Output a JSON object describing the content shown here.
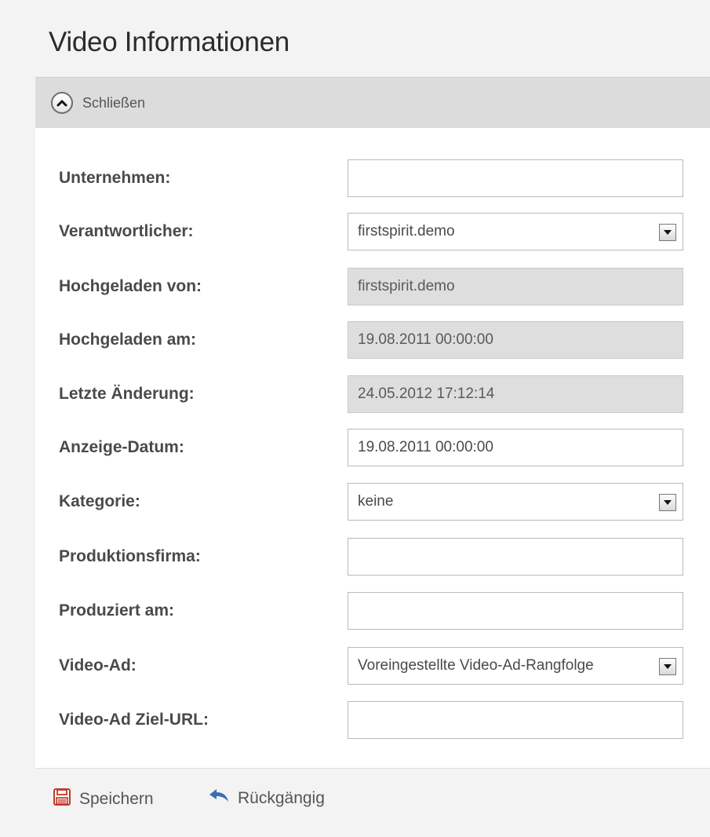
{
  "panel": {
    "title": "Video Informationen",
    "collapse_label": "Schließen"
  },
  "form": {
    "rows": [
      {
        "label": "Unternehmen:",
        "value": "",
        "type": "text"
      },
      {
        "label": "Verantwortlicher:",
        "value": "firstspirit.demo",
        "type": "select"
      },
      {
        "label": "Hochgeladen von:",
        "value": "firstspirit.demo",
        "type": "readonly"
      },
      {
        "label": "Hochgeladen am:",
        "value": "19.08.2011 00:00:00",
        "type": "readonly"
      },
      {
        "label": "Letzte Änderung:",
        "value": "24.05.2012 17:12:14",
        "type": "readonly"
      },
      {
        "label": "Anzeige-Datum:",
        "value": "19.08.2011 00:00:00",
        "type": "text"
      },
      {
        "label": "Kategorie:",
        "value": "keine",
        "type": "select"
      },
      {
        "label": "Produktionsfirma:",
        "value": "",
        "type": "text"
      },
      {
        "label": "Produziert am:",
        "value": "",
        "type": "text"
      },
      {
        "label": "Video-Ad:",
        "value": "Voreingestellte Video-Ad-Rangfolge",
        "type": "select"
      },
      {
        "label": "Video-Ad Ziel-URL:",
        "value": "",
        "type": "text"
      }
    ]
  },
  "footer": {
    "save_label": "Speichern",
    "undo_label": "Rückgängig"
  },
  "icons": {
    "collapse": "chevron-up-circle-icon",
    "save": "floppy-disk-icon",
    "undo": "undo-arrow-icon"
  },
  "colors": {
    "save_icon": "#c0392b",
    "undo_icon": "#3a6fb5"
  }
}
